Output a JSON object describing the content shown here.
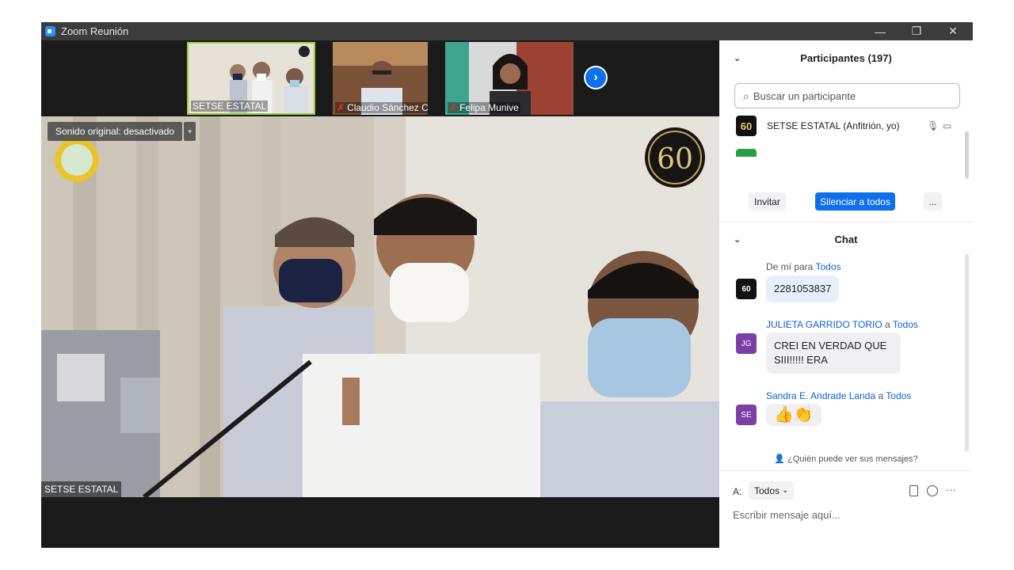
{
  "window": {
    "title": "Zoom Reunión",
    "minimize": "—",
    "restore": "❐",
    "close": "✕"
  },
  "thumbnails": [
    {
      "name": "SETSE ESTATAL",
      "muted": false,
      "active": true
    },
    {
      "name": "Claudio Sánchez Cruz",
      "muted": true,
      "active": false
    },
    {
      "name": "Felipa Munive",
      "muted": true,
      "active": false
    }
  ],
  "thumb_icons": {
    "mic_muted": "✗",
    "next": "›"
  },
  "main_video": {
    "sound_label": "Sonido original: desactivado",
    "sound_dropdown": "▾",
    "speaker_label": "SETSE ESTATAL",
    "badge_text": "60"
  },
  "participants": {
    "title": "Participantes (197)",
    "collapse_icon": "⌄",
    "search_placeholder": "Buscar un participante",
    "search_icon": "⌕",
    "rows": [
      {
        "name": "SETSE ESTATAL (Anfitrión, yo)",
        "avatar_text": "60"
      }
    ],
    "row_icons": {
      "mic": "🎙",
      "video": "▭"
    },
    "invite": "Invitar",
    "mute_all": "Silenciar a todos",
    "more": "..."
  },
  "chat": {
    "title": "Chat",
    "collapse_icon": "⌄",
    "messages": [
      {
        "from": "De mí para",
        "to": "Todos",
        "text": "2281053837",
        "avatar": "60"
      },
      {
        "from": "JULIETA GARRIDO TORIO",
        "sep": "a",
        "to": "Todos",
        "text": "CREI EN VERDAD QUE SIII!!!!! ERA",
        "avatar": "JG"
      },
      {
        "from": "Sandra E. Andrade Landa",
        "sep": "a",
        "to": "Todos",
        "text": "👍👏",
        "avatar": "SE"
      }
    ],
    "who_can_see": "¿Quién puede ver sus mensajes?",
    "to_label": "A:",
    "to_value": "Todos",
    "to_caret": "⌄",
    "placeholder": "Escribir mensaje aquí...",
    "more": "···"
  },
  "colors": {
    "accent": "#0e71eb",
    "avatar_purple": "#7b3fa6",
    "muted_red": "#e02828"
  }
}
